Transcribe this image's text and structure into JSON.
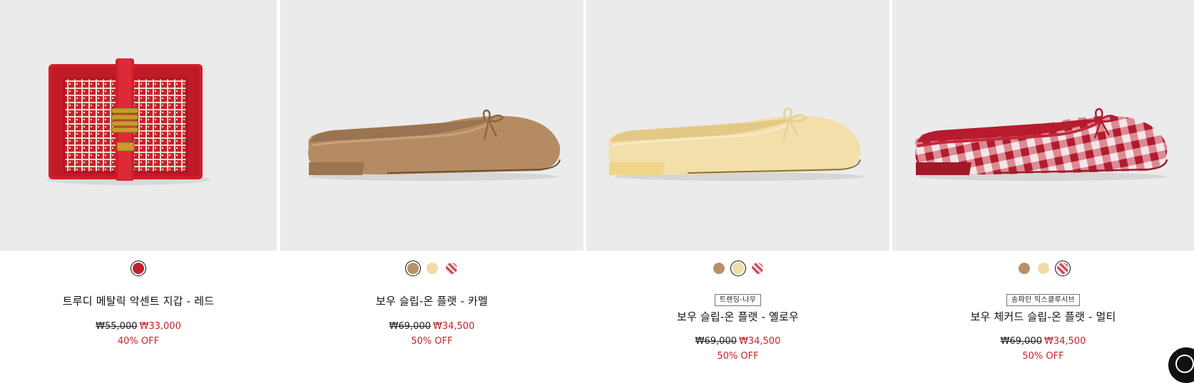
{
  "products": [
    {
      "name": "트루디 메탈릭 악센트 지갑 - 레드",
      "tag": "",
      "original_price": "₩55,000",
      "sale_price": "₩33,000",
      "discount": "40% OFF",
      "swatches": [
        {
          "color": "#c4202c",
          "selected": true
        }
      ]
    },
    {
      "name": "보우 슬립-온 플랫 - 카멜",
      "tag": "",
      "original_price": "₩69,000",
      "sale_price": "₩34,500",
      "discount": "50% OFF",
      "swatches": [
        {
          "color": "#b89068",
          "selected": true
        },
        {
          "color": "#f1dca8",
          "selected": false
        },
        {
          "color": "#c94a5a",
          "selected": false
        }
      ]
    },
    {
      "name": "보우 슬립-온 플랫 - 옐로우",
      "tag": "트렌딩-나우",
      "original_price": "₩69,000",
      "sale_price": "₩34,500",
      "discount": "50% OFF",
      "swatches": [
        {
          "color": "#b89068",
          "selected": false
        },
        {
          "color": "#f1dca8",
          "selected": true
        },
        {
          "color": "#c94a5a",
          "selected": false
        }
      ]
    },
    {
      "name": "보우 체커드 슬립-온 플랫 - 멀티",
      "tag": "송파인 익스클루시브",
      "original_price": "₩69,000",
      "sale_price": "₩34,500",
      "discount": "50% OFF",
      "swatches": [
        {
          "color": "#b89068",
          "selected": false
        },
        {
          "color": "#f1dca8",
          "selected": false
        },
        {
          "color": "#c94a5a",
          "selected": true
        }
      ]
    }
  ],
  "colors": {
    "sale_red": "#c0252b",
    "image_bg": "#ebebeb"
  },
  "icons": {
    "chat": "chat-icon"
  }
}
